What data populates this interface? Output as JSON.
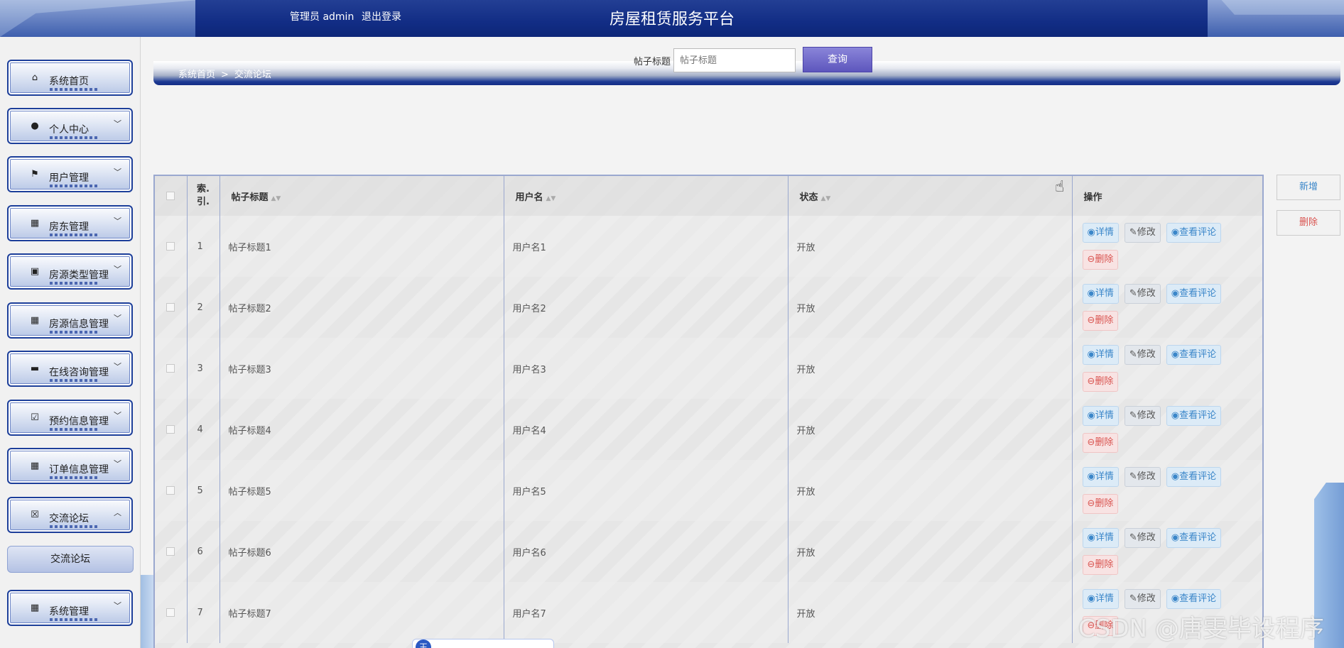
{
  "header": {
    "admin_label": "管理员 admin",
    "logout": "退出登录",
    "title": "房屋租赁服务平台"
  },
  "sidebar": {
    "items": [
      {
        "label": "系统首页",
        "icon": "home-icon",
        "glyph": "⌂",
        "expandable": false
      },
      {
        "label": "个人中心",
        "icon": "user-icon",
        "glyph": "●",
        "expandable": true
      },
      {
        "label": "用户管理",
        "icon": "flag-icon",
        "glyph": "⚑",
        "expandable": true
      },
      {
        "label": "房东管理",
        "icon": "grid-icon",
        "glyph": "▦",
        "expandable": true
      },
      {
        "label": "房源类型管理",
        "icon": "chart-icon",
        "glyph": "▣",
        "expandable": true
      },
      {
        "label": "房源信息管理",
        "icon": "grid-icon",
        "glyph": "▦",
        "expandable": true
      },
      {
        "label": "在线咨询管理",
        "icon": "wallet-icon",
        "glyph": "▬",
        "expandable": true
      },
      {
        "label": "预约信息管理",
        "icon": "clipboard-check-icon",
        "glyph": "☑",
        "expandable": true
      },
      {
        "label": "订单信息管理",
        "icon": "grid-icon",
        "glyph": "▦",
        "expandable": true
      },
      {
        "label": "交流论坛",
        "icon": "clipboard-x-icon",
        "glyph": "☒",
        "expandable": true,
        "expanded": true
      },
      {
        "label": "系统管理",
        "icon": "grid-icon",
        "glyph": "▦",
        "expandable": true
      }
    ],
    "submenu": "交流论坛"
  },
  "breadcrumb": {
    "home": "系统首页",
    "sep": ">",
    "current": "交流论坛"
  },
  "search": {
    "label": "帖子标题",
    "placeholder": "帖子标题",
    "button": "查询"
  },
  "table": {
    "columns": [
      "帖子标题",
      "用户名",
      "状态",
      "操作"
    ],
    "index_header_1": "索.",
    "index_header_2": "引.",
    "rows": [
      {
        "index": "1",
        "title": "帖子标题1",
        "username": "用户名1",
        "status": "开放"
      },
      {
        "index": "2",
        "title": "帖子标题2",
        "username": "用户名2",
        "status": "开放"
      },
      {
        "index": "3",
        "title": "帖子标题3",
        "username": "用户名3",
        "status": "开放"
      },
      {
        "index": "4",
        "title": "帖子标题4",
        "username": "用户名4",
        "status": "开放"
      },
      {
        "index": "5",
        "title": "帖子标题5",
        "username": "用户名5",
        "status": "开放"
      },
      {
        "index": "6",
        "title": "帖子标题6",
        "username": "用户名6",
        "status": "开放"
      },
      {
        "index": "7",
        "title": "帖子标题7",
        "username": "用户名7",
        "status": "开放"
      }
    ],
    "actions": {
      "detail": "详情",
      "edit": "修改",
      "comments": "查看评论",
      "delete": "删除"
    }
  },
  "side_buttons": {
    "add": "新增",
    "delete": "删除"
  },
  "toolbar_badge": "王",
  "watermark": "CSDN @唐雯毕设程序"
}
